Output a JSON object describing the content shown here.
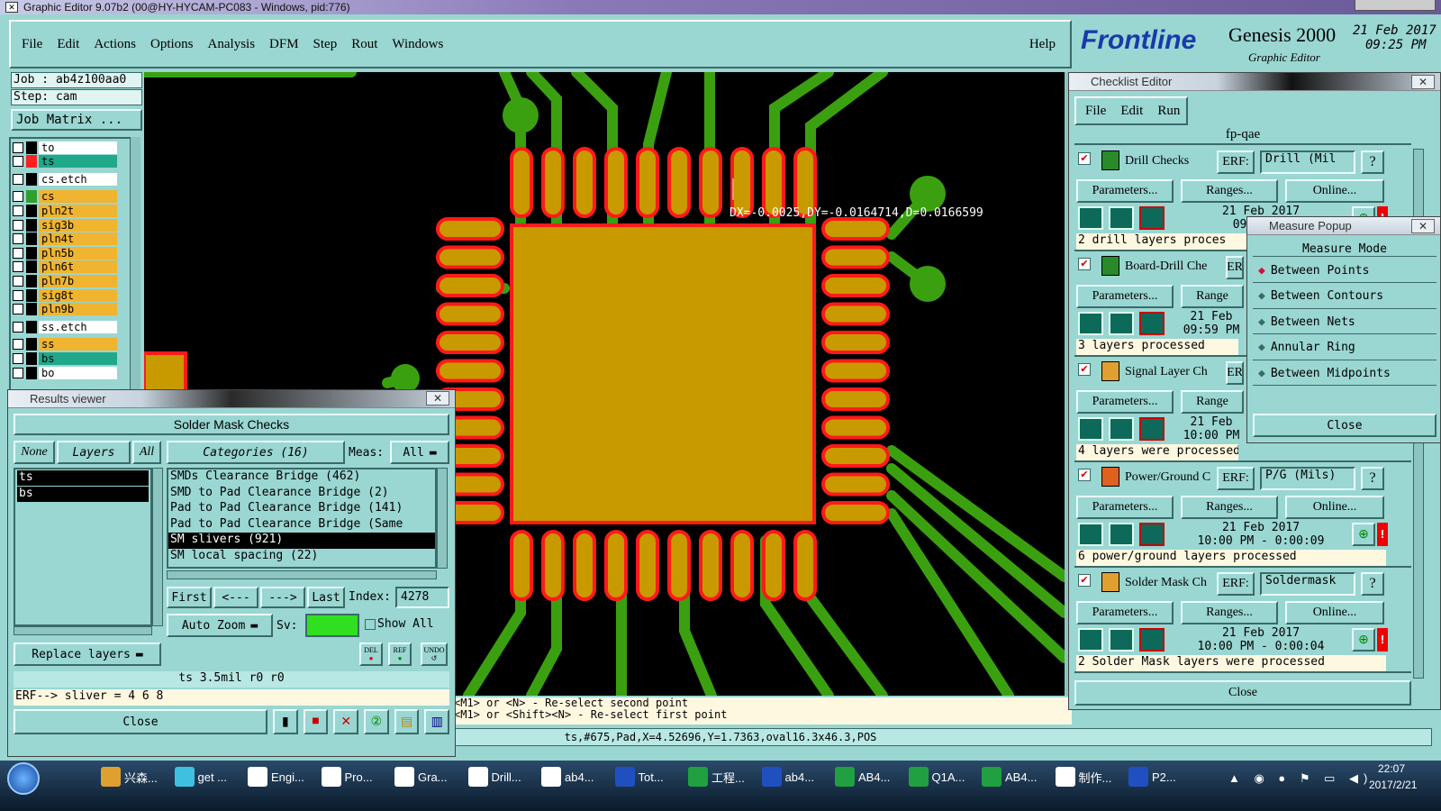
{
  "window_title": "Graphic Editor 9.07b2 (00@HY-HYCAM-PC083 - Windows, pid:776)",
  "menu": [
    "File",
    "Edit",
    "Actions",
    "Options",
    "Analysis",
    "DFM",
    "Step",
    "Rout",
    "Windows"
  ],
  "help": "Help",
  "brand": {
    "logo": "Frontline",
    "product": "Genesis 2000",
    "subtitle": "Graphic Editor",
    "date": "21 Feb 2017",
    "time": "09:25 PM"
  },
  "job": {
    "job": "Job : ab4z100aa0",
    "step": "Step: cam",
    "matrix": "Job Matrix ..."
  },
  "layers": [
    {
      "name": "to",
      "color": "#ffffff",
      "swatch": "#000000"
    },
    {
      "name": "ts",
      "color": "#1fa88a",
      "swatch": "#ff2020"
    },
    {
      "name": "cs.etch",
      "color": "#ffffff",
      "swatch": "#000000"
    },
    {
      "name": "cs",
      "color": "#f0b430",
      "swatch": "#2ea02e"
    },
    {
      "name": "pln2t",
      "color": "#f0b430",
      "swatch": "#000000"
    },
    {
      "name": "sig3b",
      "color": "#f0b430",
      "swatch": "#000000"
    },
    {
      "name": "pln4t",
      "color": "#f0b430",
      "swatch": "#000000"
    },
    {
      "name": "pln5b",
      "color": "#f0b430",
      "swatch": "#000000"
    },
    {
      "name": "pln6t",
      "color": "#f0b430",
      "swatch": "#000000"
    },
    {
      "name": "pln7b",
      "color": "#f0b430",
      "swatch": "#000000"
    },
    {
      "name": "sig8t",
      "color": "#f0b430",
      "swatch": "#000000"
    },
    {
      "name": "pln9b",
      "color": "#f0b430",
      "swatch": "#000000"
    },
    {
      "name": "ss.etch",
      "color": "#ffffff",
      "swatch": "#000000"
    },
    {
      "name": "ss",
      "color": "#f0b430",
      "swatch": "#000000"
    },
    {
      "name": "bs",
      "color": "#1fa88a",
      "swatch": "#000000"
    },
    {
      "name": "bo",
      "color": "#ffffff",
      "swatch": "#000000"
    }
  ],
  "measure_readout": "DX=-0.0025,DY=-0.0164714,D=0.0166599",
  "hints": [
    "<M1> or <N> - Re-select second point",
    "<M1> or <Shift><N> - Re-select first point"
  ],
  "status_bar": "ts,#675,Pad,X=4.52696,Y=1.7363,oval16.3x46.3,POS",
  "results": {
    "title": "Results viewer",
    "header": "Solder Mask Checks",
    "none": "None",
    "layers": "Layers",
    "all": "All",
    "categories": "Categories (16)",
    "meas": "Meas:",
    "meas_val": "All",
    "layer_list": [
      "ts",
      "bs"
    ],
    "items": [
      "SMDs Clearance Bridge (462)",
      "SMD to Pad Clearance Bridge (2)",
      "Pad to Pad Clearance Bridge (141)",
      "Pad to Pad Clearance Bridge (Same",
      "SM slivers (921)",
      "SM local spacing (22)"
    ],
    "selected": 4,
    "nav": [
      "First",
      "<---",
      "--->",
      "Last"
    ],
    "index_label": "Index:",
    "index": "4278",
    "auto_zoom": "Auto Zoom",
    "sv": "Sv:",
    "show_all": "Show All",
    "replace": "Replace layers",
    "tool_icons": [
      "DEL",
      "REF",
      "UNDO"
    ],
    "info": "ts 3.5mil  r0  r0",
    "erf": "ERF--> sliver = 4 6 8",
    "close": "Close"
  },
  "checklist": {
    "title": "Checklist Editor",
    "menu": [
      "File",
      "Edit",
      "Run"
    ],
    "name": "fp-qae",
    "checks": [
      {
        "name": "Drill Checks",
        "erf_label": "ERF:",
        "erf": "Drill (Mil",
        "date": "21 Feb 2017",
        "time": "09:59 PM",
        "status": "2 drill layers proces"
      },
      {
        "name": "Board-Drill Che",
        "erf_label": "ER",
        "erf": "",
        "date": "21 Feb",
        "time": "09:59 PM",
        "status": "3 layers processed"
      },
      {
        "name": "Signal Layer Ch",
        "erf_label": "ER",
        "erf": "",
        "date": "21 Feb",
        "time": "10:00 PM",
        "status": "4 layers were processed"
      },
      {
        "name": "Power/Ground C",
        "erf_label": "ERF:",
        "erf": "P/G (Mils)",
        "date": "21 Feb 2017",
        "time": "10:00 PM - 0:00:09",
        "status": "6 power/ground layers processed"
      },
      {
        "name": "Solder Mask Ch",
        "erf_label": "ERF:",
        "erf": "Soldermask",
        "date": "21 Feb 2017",
        "time": "10:00 PM - 0:00:04",
        "status": "2 Solder Mask layers were processed"
      }
    ],
    "params": "Parameters...",
    "ranges": "Ranges...",
    "online": "Online...",
    "ranges_short": "Range",
    "close": "Close"
  },
  "measure": {
    "title": "Measure Popup",
    "mode": "Measure Mode",
    "options": [
      "Between Points",
      "Between Contours",
      "Between Nets",
      "Annular Ring",
      "Between Midpoints"
    ],
    "selected": 0,
    "close": "Close"
  },
  "taskbar": {
    "items": [
      "兴森...",
      "get ...",
      "Engi...",
      "Pro...",
      "Gra...",
      "Drill...",
      "ab4...",
      "Tot...",
      "工程...",
      "ab4...",
      "AB4...",
      "Q1A...",
      "AB4...",
      "制作...",
      "P2..."
    ],
    "time": "22:07",
    "date": "2017/2/21"
  },
  "colors": {
    "teal": "#9ad6d2",
    "board": "#000000",
    "pad": "#c89a00",
    "pad_outline": "#ff1a1a",
    "trace": "#3aa010"
  }
}
